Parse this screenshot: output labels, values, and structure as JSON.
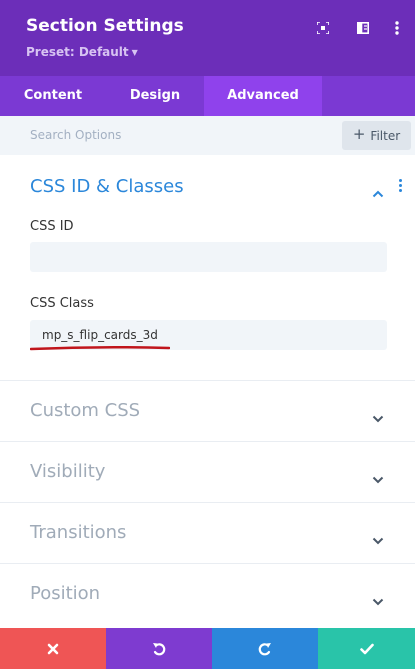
{
  "header": {
    "title": "Section Settings",
    "preset": "Preset: Default",
    "icons": [
      "expand-icon",
      "split-view-icon",
      "more-icon"
    ],
    "color": "#6c2eb9"
  },
  "tabs": [
    {
      "label": "Content",
      "active": false
    },
    {
      "label": "Design",
      "active": false
    },
    {
      "label": "Advanced",
      "active": true
    }
  ],
  "search": {
    "placeholder": "Search Options",
    "filter_label": "Filter"
  },
  "groups": {
    "css": {
      "title": "CSS ID & Classes",
      "expanded": true,
      "fields": [
        {
          "label": "CSS ID",
          "value": ""
        },
        {
          "label": "CSS Class",
          "value": "mp_s_flip_cards_3d"
        }
      ]
    },
    "collapsed": [
      {
        "title": "Custom CSS"
      },
      {
        "title": "Visibility"
      },
      {
        "title": "Transitions"
      },
      {
        "title": "Position"
      }
    ]
  },
  "footer": {
    "buttons": [
      {
        "action": "discard",
        "icon": "close-icon",
        "color": "#ef5555"
      },
      {
        "action": "undo",
        "icon": "undo-icon",
        "color": "#7e3bd0"
      },
      {
        "action": "redo",
        "icon": "redo-icon",
        "color": "#2b87da"
      },
      {
        "action": "save",
        "icon": "check-icon",
        "color": "#29c4a9"
      }
    ]
  },
  "colors": {
    "accent": "#2b87da",
    "annotation": "#c0151c"
  }
}
